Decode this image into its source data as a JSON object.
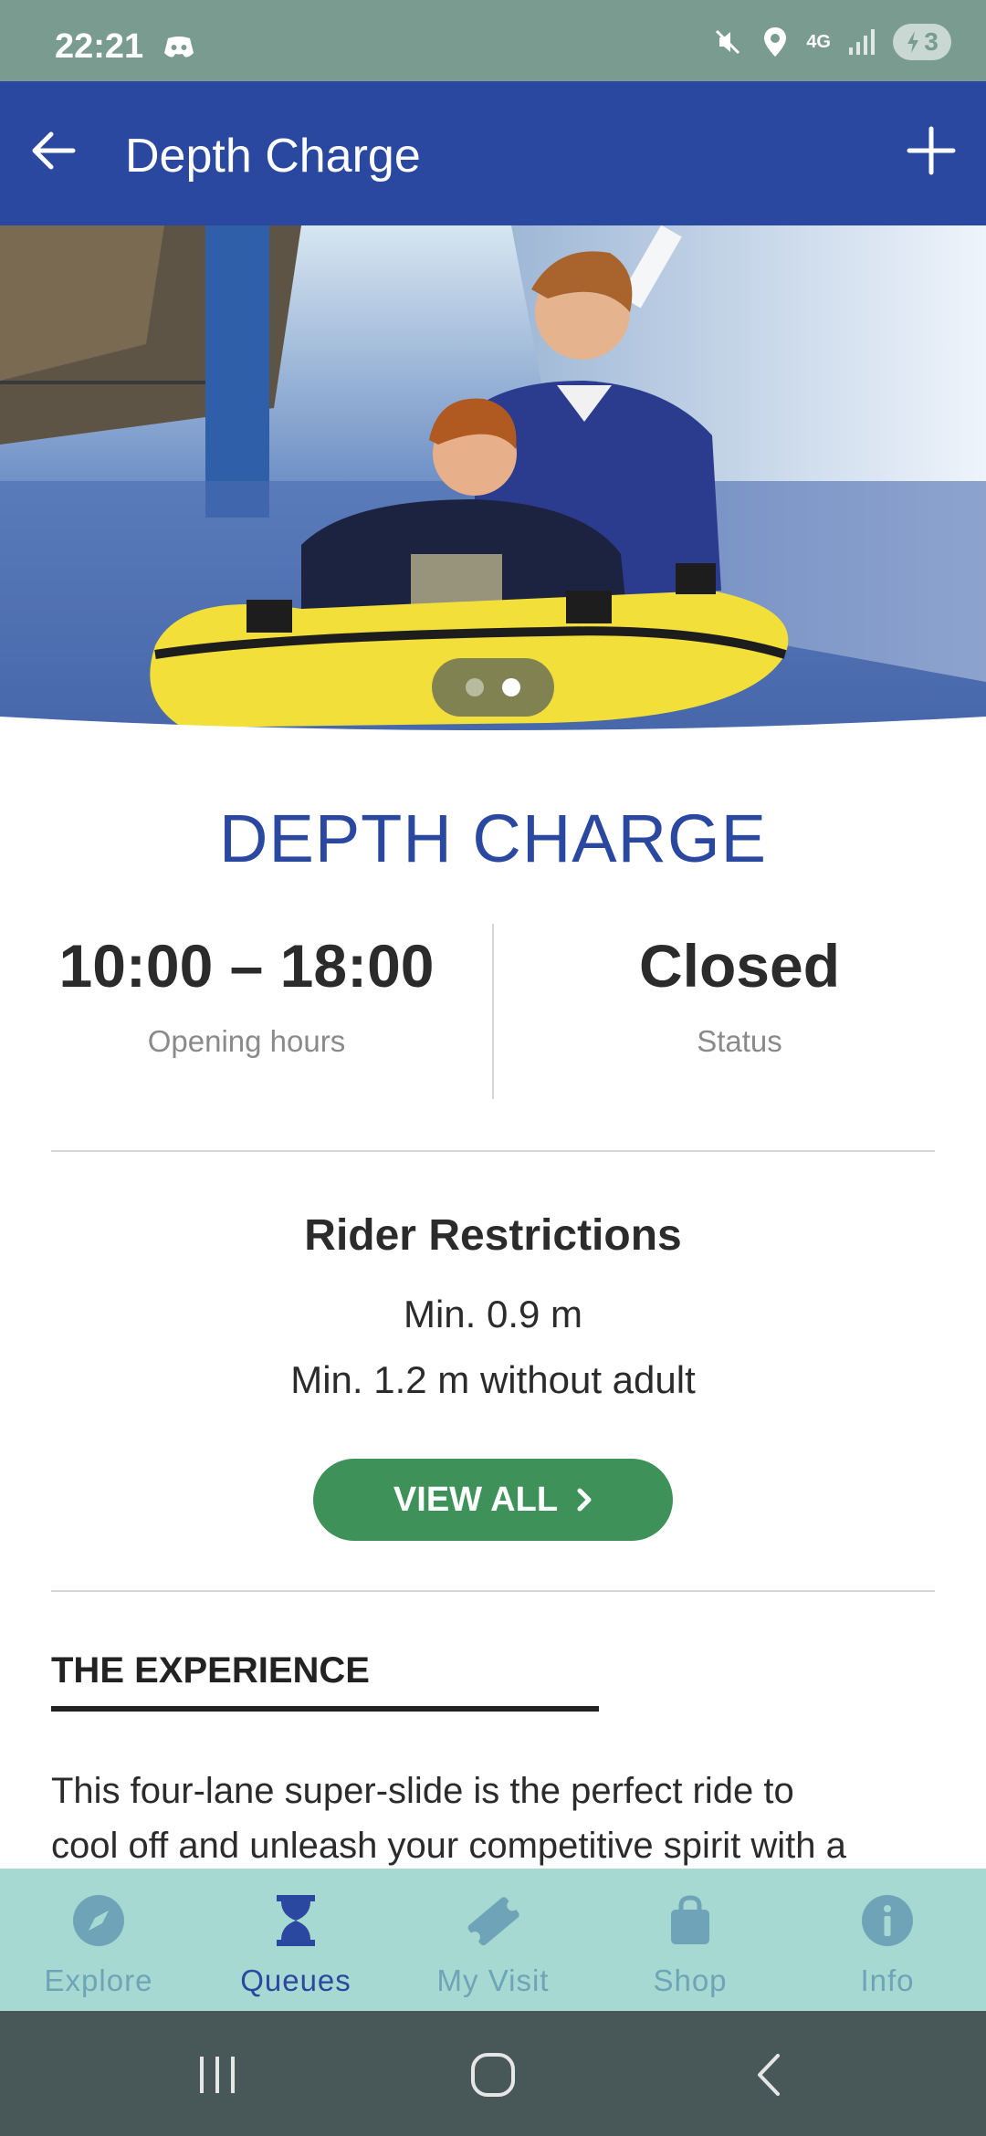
{
  "status_bar": {
    "time": "22:21",
    "network": "4G",
    "battery": "3"
  },
  "app_bar": {
    "title": "Depth Charge"
  },
  "hero": {
    "carousel_index": 2,
    "carousel_count": 2
  },
  "ride": {
    "name": "DEPTH CHARGE",
    "opening_hours": "10:00 – 18:00",
    "opening_hours_label": "Opening hours",
    "status": "Closed",
    "status_label": "Status"
  },
  "restrictions": {
    "title": "Rider Restrictions",
    "lines": [
      "Min. 0.9 m",
      "Min. 1.2 m without adult"
    ],
    "button_label": "VIEW ALL"
  },
  "experience": {
    "heading": "THE EXPERIENCE",
    "lines": [
      "This four-lane super-slide is the perfect ride to",
      "cool off and unleash your competitive spirit with a"
    ]
  },
  "bottom_nav": {
    "selected": "Queues",
    "items": [
      {
        "label": "Explore",
        "icon": "compass-icon"
      },
      {
        "label": "Queues",
        "icon": "hourglass-icon"
      },
      {
        "label": "My Visit",
        "icon": "ticket-icon"
      },
      {
        "label": "Shop",
        "icon": "shopping-bag-icon"
      },
      {
        "label": "Info",
        "icon": "info-icon"
      }
    ]
  },
  "colors": {
    "status_bar": "#7a9b8f",
    "app_bar": "#2a48a0",
    "accent_blue": "#2a48a0",
    "button_green": "#3e9159",
    "bottom_nav": "#a5d9d1",
    "nav_inactive": "#6fa4b8",
    "system_nav": "#485858"
  }
}
